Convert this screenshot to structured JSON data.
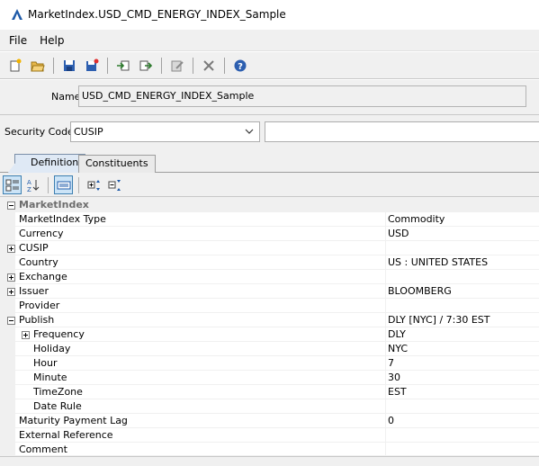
{
  "window": {
    "title": "MarketIndex.USD_CMD_ENERGY_INDEX_Sample"
  },
  "menu": [
    "File",
    "Help"
  ],
  "toolbar": {
    "icons": [
      "new-icon",
      "open-icon",
      "save-icon",
      "save-as-icon",
      "import-icon",
      "export-icon",
      "edit-icon",
      "delete-icon",
      "help-icon"
    ]
  },
  "form": {
    "name_label": "Name",
    "name_value": "USD_CMD_ENERGY_INDEX_Sample",
    "security_code_label": "Security Code",
    "security_code_value": "CUSIP",
    "security_code_input": ""
  },
  "tabs": [
    "Definition",
    "Constituents"
  ],
  "grid": {
    "category": "MarketIndex",
    "rows": [
      {
        "label": "MarketIndex Type",
        "value": "Commodity",
        "expander": ""
      },
      {
        "label": "Currency",
        "value": "USD",
        "expander": ""
      },
      {
        "label": "CUSIP",
        "value": "",
        "expander": "plus"
      },
      {
        "label": "Country",
        "value": "US : UNITED STATES",
        "expander": ""
      },
      {
        "label": "Exchange",
        "value": "",
        "expander": "plus"
      },
      {
        "label": "Issuer",
        "value": "BLOOMBERG",
        "expander": "plus"
      },
      {
        "label": "Provider",
        "value": "",
        "expander": ""
      },
      {
        "label": "Publish",
        "value": "DLY [NYC] / 7:30 EST",
        "expander": "minus"
      },
      {
        "label": "Frequency",
        "value": "DLY",
        "expander": "plus"
      },
      {
        "label": "Holiday",
        "value": "NYC",
        "expander": ""
      },
      {
        "label": "Hour",
        "value": "7",
        "expander": ""
      },
      {
        "label": "Minute",
        "value": "30",
        "expander": ""
      },
      {
        "label": "TimeZone",
        "value": "EST",
        "expander": ""
      },
      {
        "label": "Date Rule",
        "value": "",
        "expander": ""
      },
      {
        "label": "Maturity Payment Lag",
        "value": "0",
        "expander": ""
      },
      {
        "label": "External Reference",
        "value": "",
        "expander": ""
      },
      {
        "label": "Comment",
        "value": "",
        "expander": ""
      }
    ]
  },
  "colors": {
    "accent": "#1e5aa8",
    "panel": "#f0f0f0",
    "category_text": "#6d6d6d"
  }
}
